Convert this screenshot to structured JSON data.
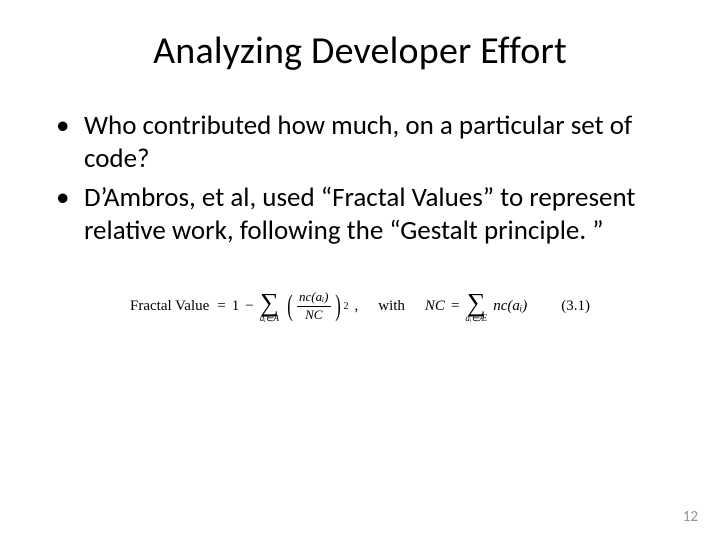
{
  "title": "Analyzing Developer Effort",
  "bullets": [
    "Who contributed how much, on a particular set of code?",
    "D’Ambros, et al, used “Fractal Values” to represent relative work, following the “Gestalt principle. ”"
  ],
  "formula": {
    "label": "Fractal Value",
    "eq": "=",
    "one": "1",
    "minus": "−",
    "sum_under_left": "aᵢ∈A",
    "frac_num": "nc(aᵢ)",
    "frac_den": "NC",
    "squared": "2",
    "comma": ",",
    "with": "with",
    "NC": "NC",
    "sum_under_right": "aᵢ∈Æ",
    "rhs": "nc(aᵢ)",
    "eqnum": "(3.1)"
  },
  "page_number": "12"
}
